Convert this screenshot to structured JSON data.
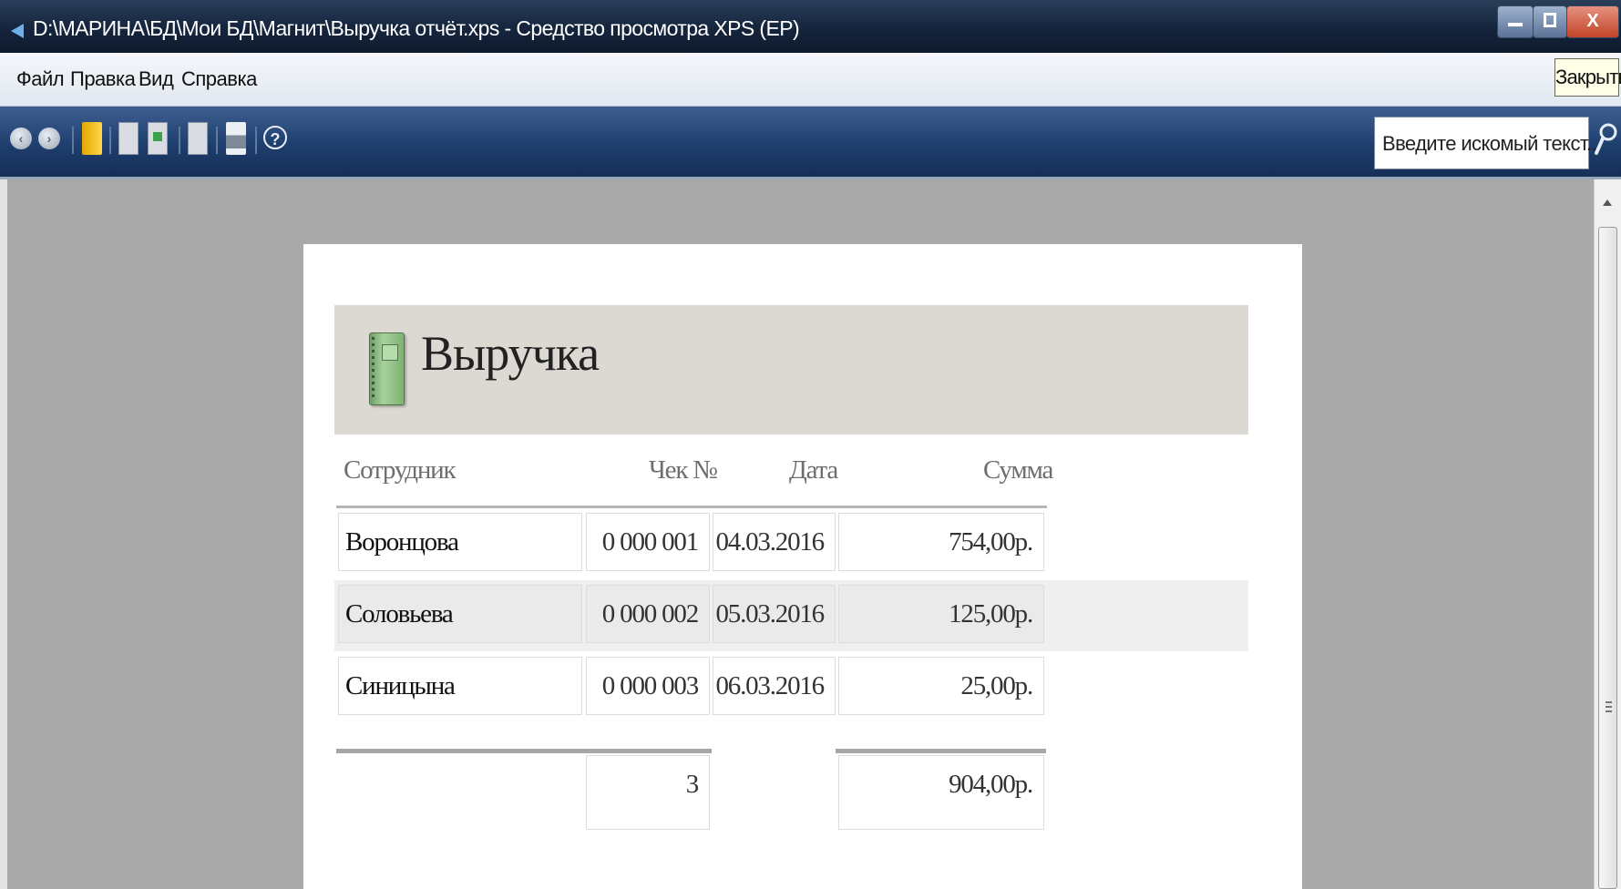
{
  "window": {
    "title": "D:\\МАРИНА\\БД\\Мои БД\\Магнит\\Выручка отчёт.xps - Средство просмотра XPS (EP)",
    "close_glyph": "X",
    "close_tooltip": "Закрыть"
  },
  "menu": {
    "items": [
      "Файл",
      "Правка",
      "Вид",
      "Справка"
    ]
  },
  "toolbar": {
    "icons": [
      "back-icon",
      "forward-icon",
      "bookmark-icon",
      "document-icon",
      "open-window-icon",
      "page-icon",
      "print-icon",
      "help-icon"
    ],
    "help_glyph": "?",
    "search_placeholder": "Введите искомый текст..."
  },
  "report": {
    "title": "Выручка",
    "columns": {
      "employee": "Сотрудник",
      "check": "Чек №",
      "date": "Дата",
      "sum": "Сумма"
    },
    "rows": [
      {
        "employee": "Воронцова",
        "check": "0 000 001",
        "date": "04.03.2016",
        "sum": "754,00р."
      },
      {
        "employee": "Соловьева",
        "check": "0 000 002",
        "date": "05.03.2016",
        "sum": "125,00р."
      },
      {
        "employee": "Синицына",
        "check": "0 000 003",
        "date": "06.03.2016",
        "sum": "25,00р."
      }
    ],
    "totals": {
      "count": "3",
      "sum": "904,00р."
    }
  },
  "colors": {
    "titlebar": "#16263f",
    "toolbar": "#1e3e6e",
    "viewer_background": "#a9a9a9",
    "report_header": "#dcd8d2",
    "row_alt": "#efefef",
    "close_button": "#c24429"
  }
}
